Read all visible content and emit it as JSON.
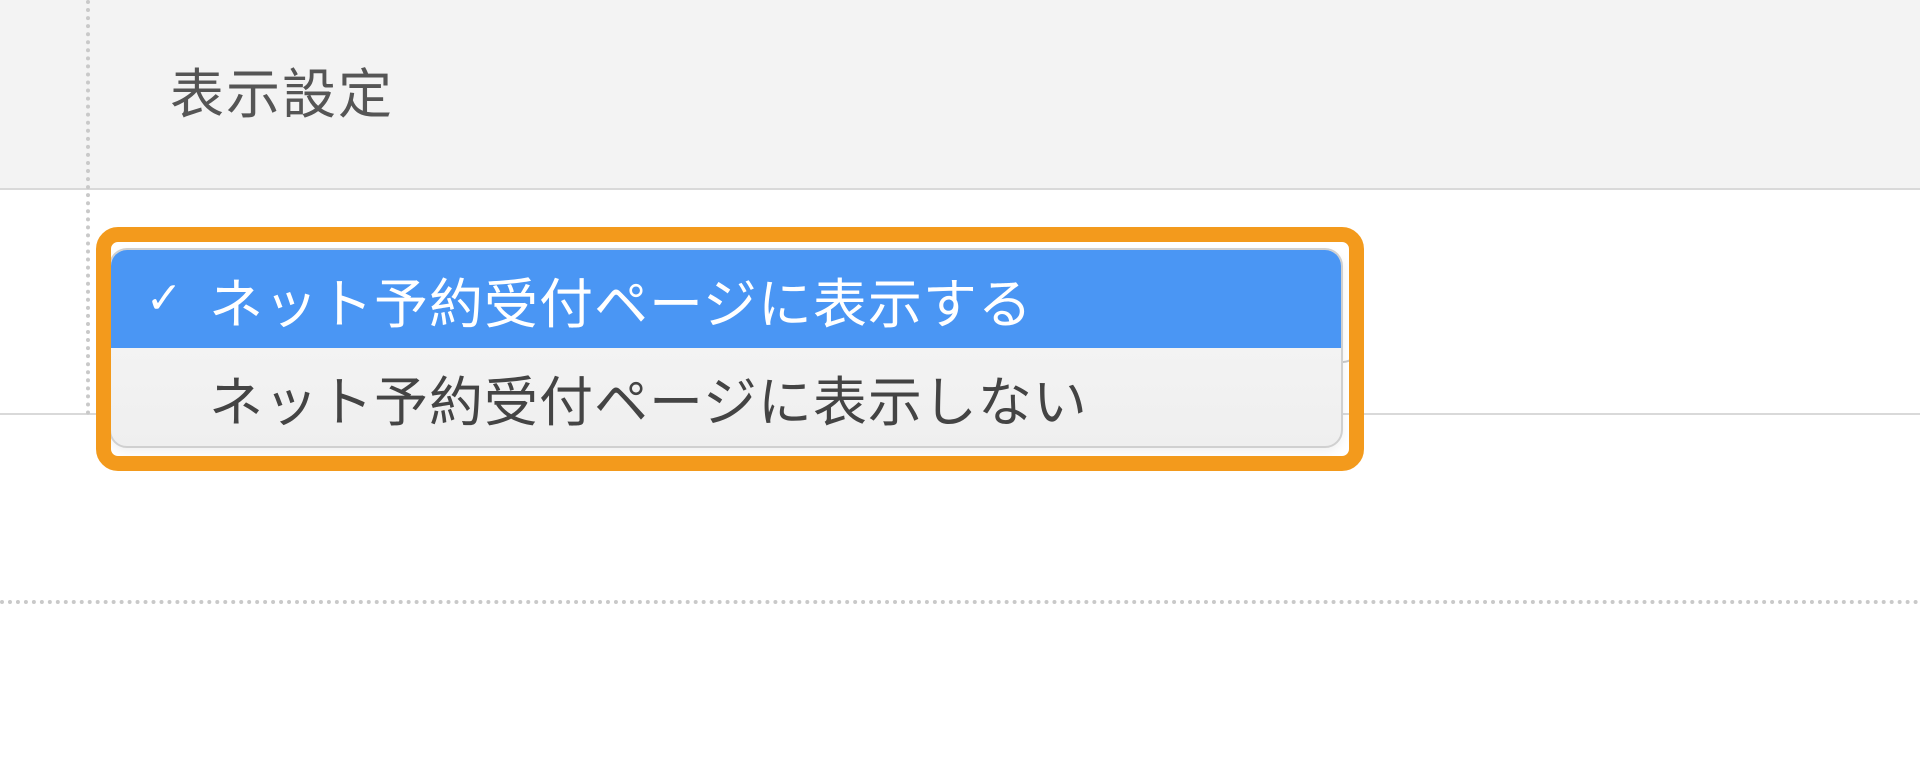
{
  "field": {
    "label": "表示設定"
  },
  "dropdown": {
    "options": [
      {
        "label": "ネット予約受付ページに表示する",
        "selected": true
      },
      {
        "label": "ネット予約受付ページに表示しない",
        "selected": false
      }
    ]
  },
  "colors": {
    "highlight": "#f39a1c",
    "selection": "#4a96f4"
  }
}
